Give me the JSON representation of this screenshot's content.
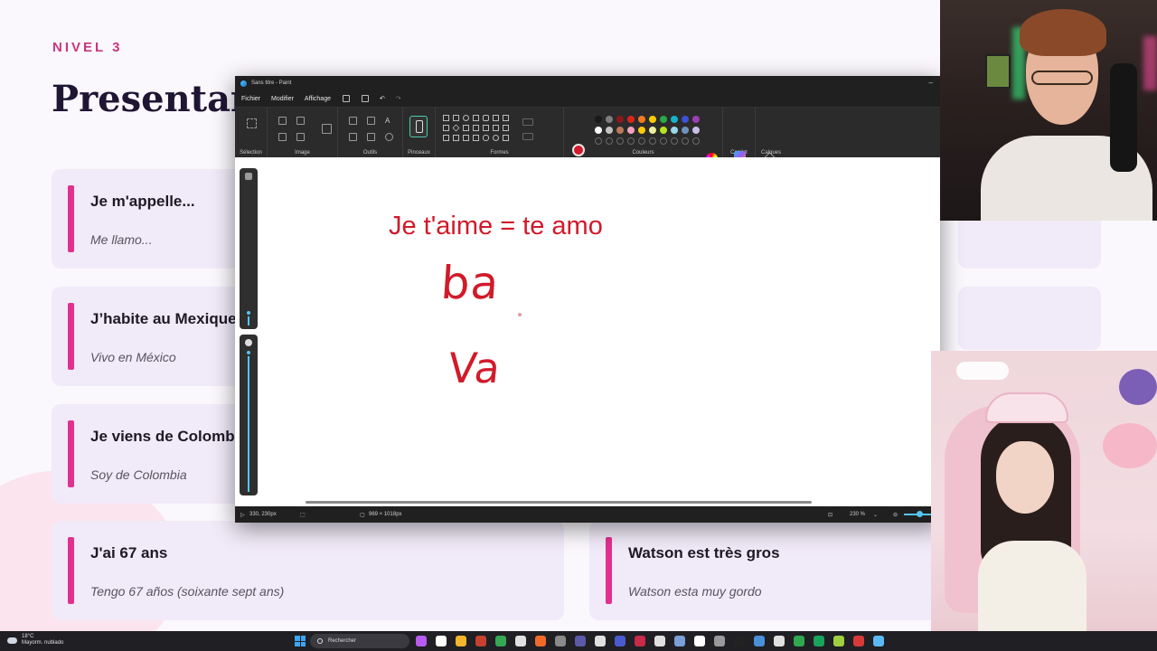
{
  "slide": {
    "level": "NIVEL 3",
    "title": "Presentar",
    "cards": [
      {
        "fr": "Je m'appelle...",
        "es": "Me llamo..."
      },
      {
        "fr": "J’habite au Mexique",
        "es": "Vivo en México"
      },
      {
        "fr": "Je viens de Colomb",
        "es": "Soy de Colombia"
      },
      {
        "fr": "J'ai 67 ans",
        "es": "Tengo 67 años (soixante sept ans)"
      },
      {
        "fr": "Watson est très gros",
        "es": "Watson esta muy gordo"
      }
    ]
  },
  "paint": {
    "window_title": "Sans titre - Paint",
    "menus": [
      "Fichier",
      "Modifier",
      "Affichage"
    ],
    "ribbon_groups": [
      "Sélection",
      "Image",
      "Outils",
      "Pinceaux",
      "Formes",
      "Couleurs",
      "Copilot",
      "Calques"
    ],
    "canvas_text": {
      "line1": "Je t'aime = te amo",
      "line2": "ba",
      "line3": "Va"
    },
    "status": {
      "cursor": "330, 230px",
      "size": "969 × 1018px",
      "zoom": "230 %"
    },
    "primary_color": "#d11a2a",
    "palette_row1": [
      "#1a1a1a",
      "#7f7f7f",
      "#8b1a1a",
      "#e0231a",
      "#f47a20",
      "#ffcc00",
      "#2aa84a",
      "#17b3c8",
      "#3f51d6",
      "#9b3fb5"
    ],
    "palette_row2": [
      "#ffffff",
      "#c3c3c3",
      "#b97a57",
      "#f7a3c0",
      "#ffc90e",
      "#eeef99",
      "#b5e61d",
      "#99d9ea",
      "#7092be",
      "#c8bfe7"
    ]
  },
  "taskbar": {
    "weather_temp": "18°C",
    "weather_desc": "Mayorm. nublado",
    "search_placeholder": "Rechercher",
    "app_icon_colors": [
      "#b85cf0",
      "#ffffff",
      "#f2b52c",
      "#c8412f",
      "#34a853",
      "#e0e0e0",
      "#f06a2a",
      "#8a8a8a",
      "#5a5aa8",
      "#e0e0e0",
      "#4a5bd0",
      "#c92a4a",
      "#e0e0e0",
      "#7aa0d8",
      "#ffffff",
      "#9a9a9a",
      "#222222",
      "#4a90d9",
      "#e0e0e0",
      "#2fa84f",
      "#1aa35a",
      "#a0d040",
      "#d83a3a",
      "#5ab9f5"
    ]
  }
}
